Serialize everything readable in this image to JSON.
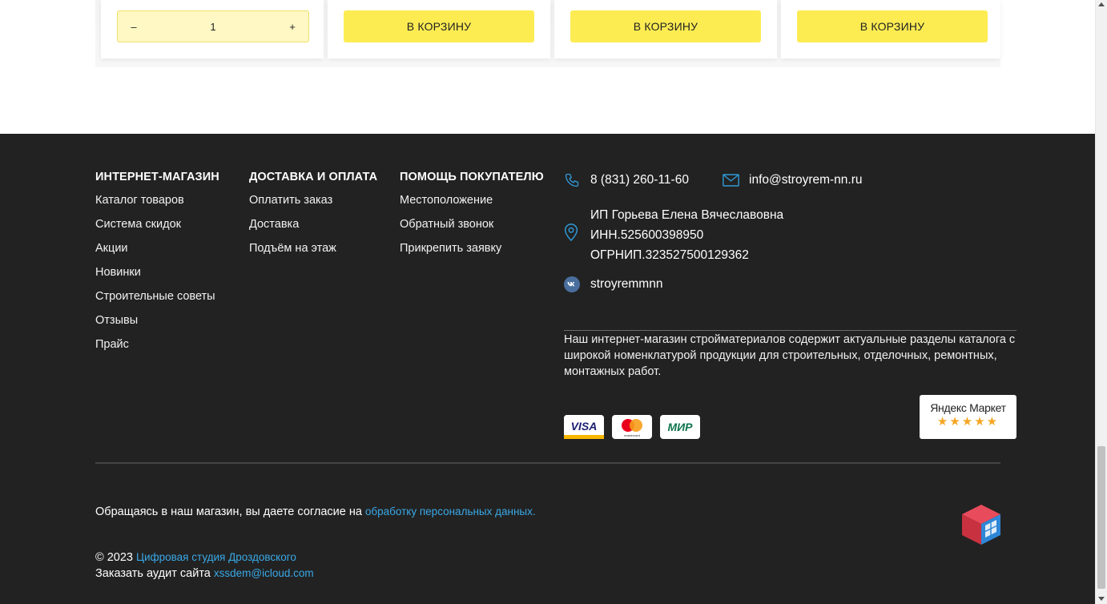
{
  "products": {
    "quantity": {
      "minus": "–",
      "value": "1",
      "plus": "+"
    },
    "add_to_cart_label": "В КОРЗИНУ"
  },
  "footer": {
    "columns": [
      {
        "heading": "ИНТЕРНЕТ-МАГАЗИН",
        "items": [
          "Каталог товаров",
          "Система скидок",
          "Акции",
          "Новинки",
          "Строительные советы",
          "Отзывы",
          "Прайс"
        ]
      },
      {
        "heading": "ДОСТАВКА И ОПЛАТА",
        "items": [
          "Оплатить заказ",
          "Доставка",
          "Подъём на этаж"
        ]
      },
      {
        "heading": "ПОМОЩЬ ПОКУПАТЕЛЮ",
        "items": [
          "Местоположение",
          "Обратный звонок",
          "Прикрепить заявку"
        ]
      }
    ],
    "contacts": {
      "phone": "8 (831) 260-11-60",
      "email": "info@stroyrem-nn.ru",
      "address_lines": [
        "ИП Горьева Елена Вячеславовна",
        "ИНН.525600398950",
        "ОГРНИП.323527500129362"
      ],
      "vk": "stroyremmnn"
    },
    "description": "Наш интернет-магазин стройматериалов содержит актуальные разделы каталога с широкой номенклатурой продукции для строительных, отделочных, ремонтных, монтажных работ.",
    "payments": {
      "visa": "VISA",
      "mastercard": "mastercard",
      "mir": "МИР"
    },
    "yandex_market": {
      "title": "Яндекс Маркет",
      "stars": "★★★★★",
      "rating": 5
    },
    "consent_text": "Обращаясь в наш магазин, вы даете согласие на ",
    "consent_link": "обработку персональных данных.",
    "copyright_prefix": "© 2023 ",
    "copyright_link": "Цифровая студия Дроздовского",
    "audit_prefix": "Заказать аудит сайта ",
    "audit_link": "xssdem@icloud.com"
  },
  "colors": {
    "footer_bg": "#222222",
    "accent_yellow": "#fcec52",
    "link_blue": "#3aa8e6",
    "icon_blue": "#2f9ad8"
  }
}
